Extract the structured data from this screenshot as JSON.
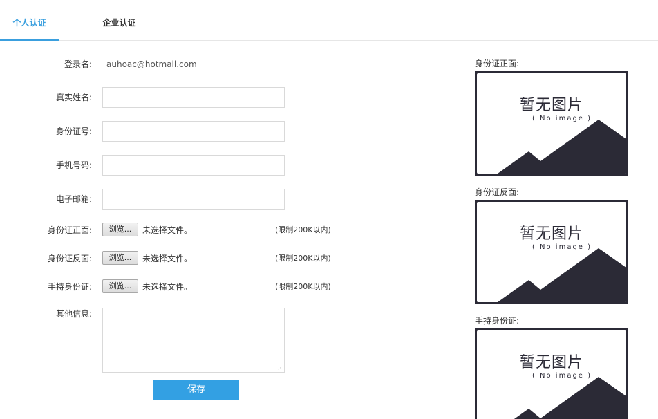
{
  "tabs": [
    {
      "label": "个人认证",
      "active": true
    },
    {
      "label": "企业认证",
      "active": false
    }
  ],
  "form": {
    "login_label": "登录名:",
    "login_value": "auhoac@hotmail.com",
    "real_name_label": "真实姓名:",
    "real_name_value": "",
    "id_number_label": "身份证号:",
    "id_number_value": "",
    "phone_label": "手机号码:",
    "phone_value": "",
    "email_label": "电子邮箱:",
    "email_value": "",
    "uploads": [
      {
        "label": "身份证正面:",
        "button": "浏览...",
        "status": "未选择文件。",
        "limit": "(限制200K以内)"
      },
      {
        "label": "身份证反面:",
        "button": "浏览...",
        "status": "未选择文件。",
        "limit": "(限制200K以内)"
      },
      {
        "label": "手持身份证:",
        "button": "浏览...",
        "status": "未选择文件。",
        "limit": "(限制200K以内)"
      }
    ],
    "other_label": "其他信息:",
    "other_value": "",
    "save_label": "保存"
  },
  "previews": [
    {
      "label": "身份证正面:",
      "title": "暂无图片",
      "subtitle": "( No image )",
      "icon": "no-image-placeholder"
    },
    {
      "label": "身份证反面:",
      "title": "暂无图片",
      "subtitle": "( No image )",
      "icon": "no-image-placeholder"
    },
    {
      "label": "手持身份证:",
      "title": "暂无图片",
      "subtitle": "( No image )",
      "icon": "no-image-placeholder"
    }
  ],
  "colors": {
    "accent": "#33a0e3",
    "placeholder_dark": "#2b2a36",
    "border": "#d9d9d9"
  }
}
